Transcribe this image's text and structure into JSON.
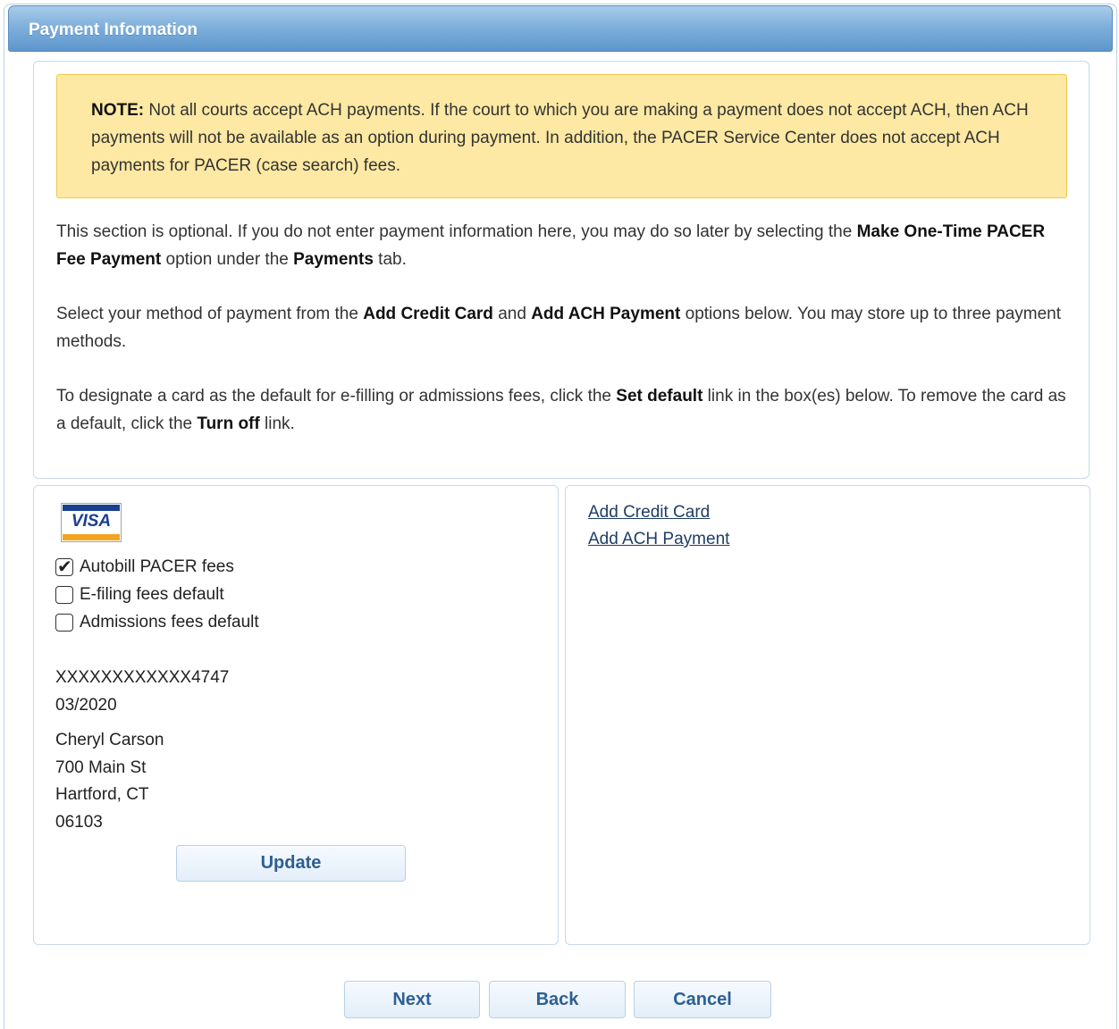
{
  "header": {
    "title": "Payment Information"
  },
  "note": {
    "label": "NOTE:",
    "text": "Not all courts accept ACH payments. If the court to which you are making a payment does not accept ACH, then ACH payments will not be available as an option during payment. In addition, the PACER Service Center does not accept ACH payments for PACER (case search) fees."
  },
  "instructions": {
    "p1": {
      "a": "This section is optional. If you do not enter payment information here, you may do so later by selecting the ",
      "b1": "Make One-Time PACER Fee Payment",
      "c": " option under the ",
      "b2": "Payments",
      "d": " tab."
    },
    "p2": {
      "a": "Select your method of payment from the ",
      "b1": "Add Credit Card",
      "c": " and ",
      "b2": "Add ACH Payment",
      "d": " options below. You may store up to three payment methods."
    },
    "p3": {
      "a": "To designate a card as the default for e-filling or admissions fees, click the ",
      "b1": "Set default",
      "c": " link in the box(es) below. To remove the card as a default, click the ",
      "b2": "Turn off",
      "d": " link."
    }
  },
  "card": {
    "brand": "VISA",
    "options": [
      {
        "label": "Autobill PACER fees",
        "checked": true
      },
      {
        "label": "E-filing fees default",
        "checked": false
      },
      {
        "label": "Admissions fees default",
        "checked": false
      }
    ],
    "number": "XXXXXXXXXXXX4747",
    "expiry": "03/2020",
    "name": "Cheryl Carson",
    "street": "700 Main St",
    "city_state": "Hartford, CT",
    "zip": "06103",
    "update_label": "Update"
  },
  "links": {
    "add_credit_card": "Add Credit Card",
    "add_ach_payment": "Add ACH Payment"
  },
  "footer": {
    "next_label": "Next",
    "back_label": "Back",
    "cancel_label": "Cancel"
  },
  "colors": {
    "header_blue": "#6fa4d6",
    "note_bg": "#fde9a3",
    "note_border": "#f2c64b",
    "button_text": "#2d5f92"
  }
}
